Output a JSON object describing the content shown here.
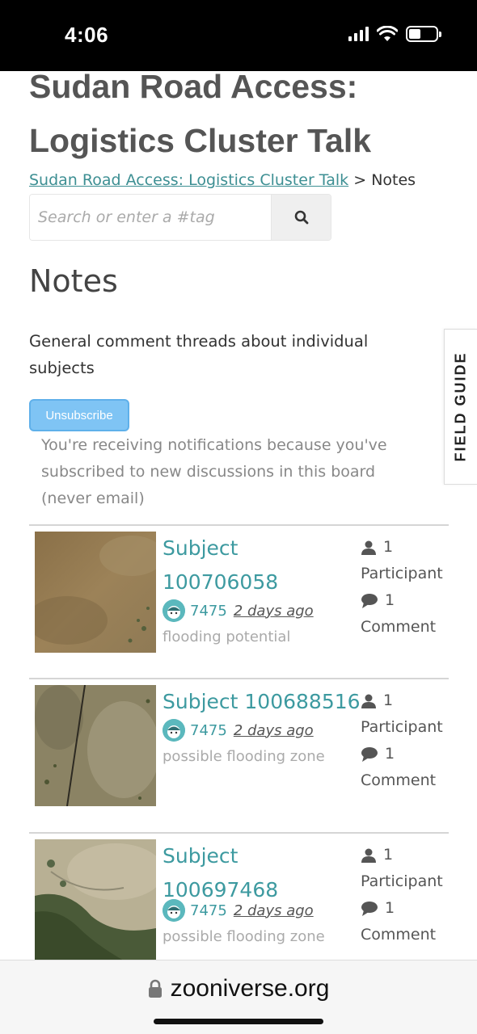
{
  "status_bar": {
    "time": "4:06"
  },
  "project": {
    "title": "Sudan Road Access: Logistics Cluster Talk"
  },
  "breadcrumb": {
    "link": "Sudan Road Access: Logistics Cluster Talk",
    "separator": ">",
    "current": "Notes"
  },
  "search": {
    "placeholder": "Search or enter a #tag"
  },
  "board": {
    "title": "Notes",
    "description": "General comment threads about individual subjects",
    "unsubscribe_label": "Unsubscribe",
    "notification_text": "You're receiving notifications because you've subscribed to new discussions in this board (never email)"
  },
  "discussions": [
    {
      "title": "Subject 100706058",
      "user": "7475",
      "time": "2 days ago",
      "tag": "flooding potential",
      "participants": "1",
      "participants_label": "Participant",
      "comments": "1",
      "comments_label": "Comment"
    },
    {
      "title": "Subject 100688516",
      "user": "7475",
      "time": "2 days ago",
      "tag": "possible flooding zone",
      "participants": "1",
      "participants_label": "Participant",
      "comments": "1",
      "comments_label": "Comment"
    },
    {
      "title": "Subject 100697468",
      "user": "7475",
      "time": "2 days ago",
      "tag": "possible flooding zone",
      "participants": "1",
      "participants_label": "Participant",
      "comments": "1",
      "comments_label": "Comment"
    }
  ],
  "field_guide": {
    "label": "FIELD GUIDE"
  },
  "browser": {
    "url": "zooniverse.org"
  },
  "colors": {
    "link_teal": "#3d9aa0",
    "button_blue": "#7fc4f4"
  }
}
